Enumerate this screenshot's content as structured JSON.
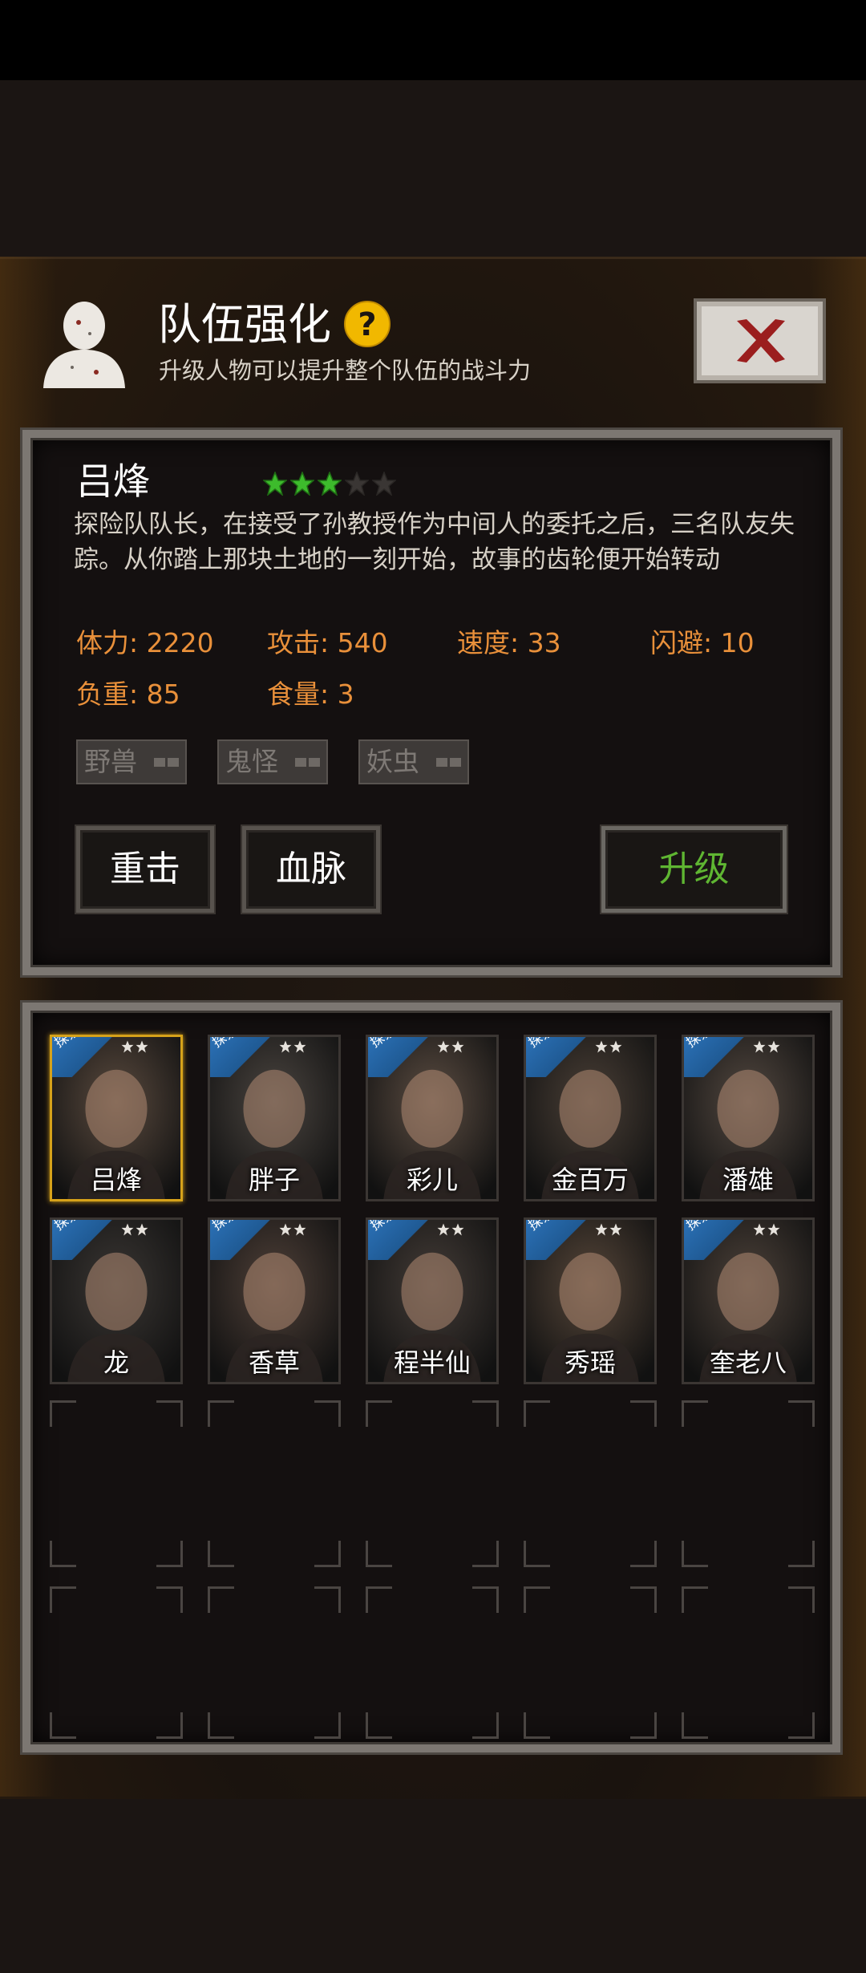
{
  "header": {
    "title": "队伍强化",
    "subtitle": "升级人物可以提升整个队伍的战斗力"
  },
  "character": {
    "name": "吕烽",
    "stars_filled": 3,
    "stars_total": 5,
    "description": "探险队队长，在接受了孙教授作为中间人的委托之后，三名队友失踪。从你踏上那块土地的一刻开始，故事的齿轮便开始转动",
    "stats": {
      "stamina": "体力: 2220",
      "attack": "攻击: 540",
      "speed": "速度: 33",
      "dodge": "闪避: 10",
      "load": "负重: 85",
      "food": "食量: 3"
    },
    "tags": [
      "野兽",
      "鬼怪",
      "妖虫"
    ]
  },
  "buttons": {
    "heavy_strike": "重击",
    "bloodline": "血脉",
    "upgrade": "升级"
  },
  "roster": {
    "explore_badge": "探索",
    "members": [
      {
        "name": "吕烽",
        "selected": true
      },
      {
        "name": "胖子",
        "selected": false
      },
      {
        "name": "彩儿",
        "selected": false
      },
      {
        "name": "金百万",
        "selected": false
      },
      {
        "name": "潘雄",
        "selected": false
      },
      {
        "name": "龙",
        "selected": false
      },
      {
        "name": "香草",
        "selected": false
      },
      {
        "name": "程半仙",
        "selected": false
      },
      {
        "name": "秀瑶",
        "selected": false
      },
      {
        "name": "奎老八",
        "selected": false
      }
    ]
  },
  "colors": {
    "accent_gold": "#d6a21a",
    "stat_orange": "#e9903a",
    "upgrade_green": "#5fb632",
    "star_green": "#3dbb2c"
  }
}
